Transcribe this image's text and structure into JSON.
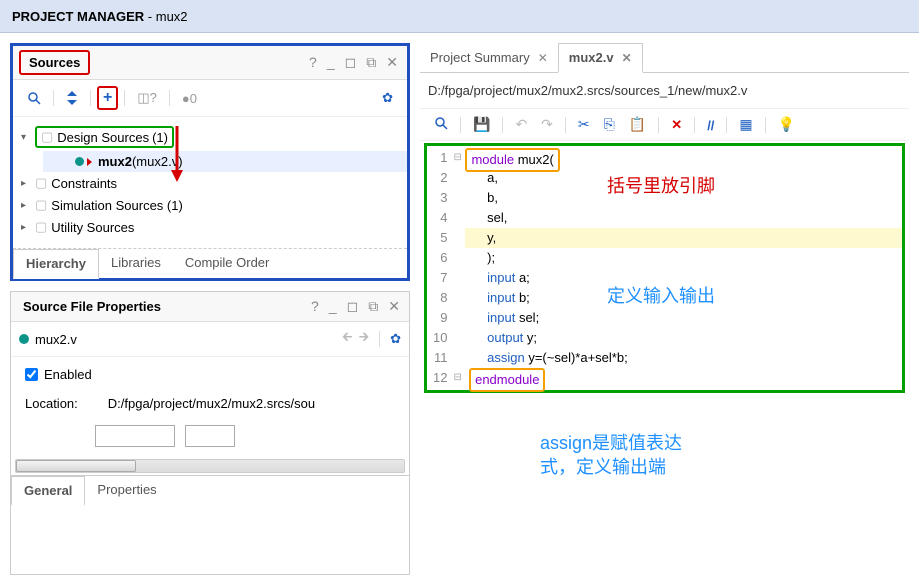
{
  "titlebar": {
    "prefix": "PROJECT MANAGER",
    "suffix": " - mux2"
  },
  "sources": {
    "title": "Sources",
    "design_sources_label": "Design Sources",
    "design_sources_count": "(1)",
    "mux2_name": "mux2",
    "mux2_file": " (mux2.v)",
    "constraints_label": "Constraints",
    "sim_sources_label": "Simulation Sources (1)",
    "utility_sources_label": "Utility Sources",
    "toolbar_zero": "0",
    "tabs": {
      "hierarchy": "Hierarchy",
      "libraries": "Libraries",
      "compile_order": "Compile Order"
    }
  },
  "properties": {
    "title": "Source File Properties",
    "file": "mux2.v",
    "enabled_label": "Enabled",
    "location_label": "Location:",
    "location_value": "D:/fpga/project/mux2/mux2.srcs/sou",
    "tabs": {
      "general": "General",
      "properties": "Properties"
    }
  },
  "editor": {
    "tabs": {
      "summary": "Project Summary",
      "file": "mux2.v"
    },
    "filepath": "D:/fpga/project/mux2/mux2.srcs/sources_1/new/mux2.v",
    "code": {
      "l1_kw": "module",
      "l1_name": " mux2(",
      "l2": "      a,",
      "l3": "      b,",
      "l4": "      sel,",
      "l5": "      y,",
      "l6": "      );",
      "l7_kw": "input",
      "l7_rest": " a;",
      "l8_kw": "input",
      "l8_rest": " b;",
      "l9_kw": "input",
      "l9_rest": " sel;",
      "l10_kw": "output",
      "l10_rest": " y;",
      "l11_kw": "assign",
      "l11_rest": " y=(~sel)*a+sel*b;",
      "l12_kw": "endmodule"
    },
    "line_numbers": [
      "1",
      "2",
      "3",
      "4",
      "5",
      "6",
      "7",
      "8",
      "9",
      "10",
      "11",
      "12"
    ]
  },
  "annotations": {
    "red1": "括号里放引脚",
    "blue1": "定义输入输出",
    "blue2a": "assign是赋值表达",
    "blue2b": "式，定义输出端"
  }
}
